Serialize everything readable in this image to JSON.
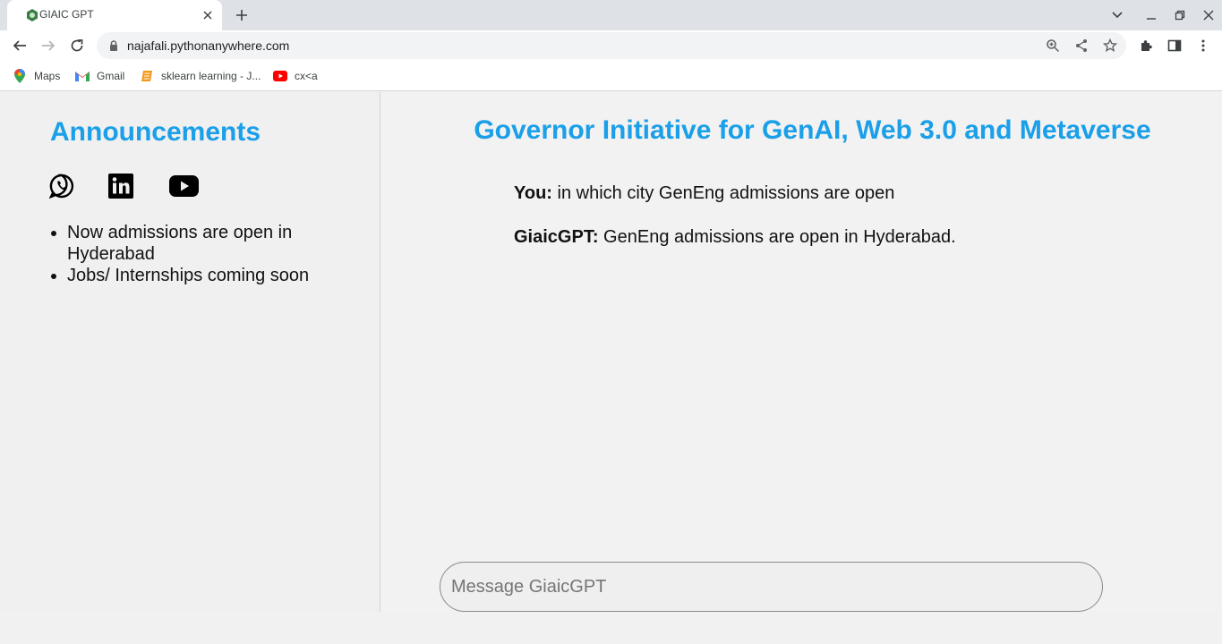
{
  "browser": {
    "tab_title": "GIAIC GPT",
    "url": "najafali.pythonanywhere.com",
    "bookmarks": [
      {
        "label": "Maps",
        "icon": "maps-icon"
      },
      {
        "label": "Gmail",
        "icon": "gmail-icon"
      },
      {
        "label": "sklearn learning - J...",
        "icon": "notebook-icon"
      },
      {
        "label": "cx<a",
        "icon": "youtube-icon"
      }
    ]
  },
  "sidebar": {
    "heading": "Announcements",
    "social_icons": [
      "whatsapp-icon",
      "linkedin-icon",
      "youtube-icon"
    ],
    "announcements": [
      "Now admissions are open in Hyderabad",
      "Jobs/ Internships coming soon"
    ]
  },
  "main": {
    "title": "Governor Initiative for GenAI, Web 3.0 and Metaverse",
    "messages": [
      {
        "sender": "You:",
        "text": "in which city GenEng admissions are open"
      },
      {
        "sender": "GiaicGPT:",
        "text": "GenEng admissions are open in Hyderabad."
      }
    ],
    "input_placeholder": "Message GiaicGPT",
    "input_value": ""
  },
  "colors": {
    "accent": "#1a9fe8",
    "tabstrip": "#dee1e6",
    "page_bg": "#f2f2f2"
  }
}
